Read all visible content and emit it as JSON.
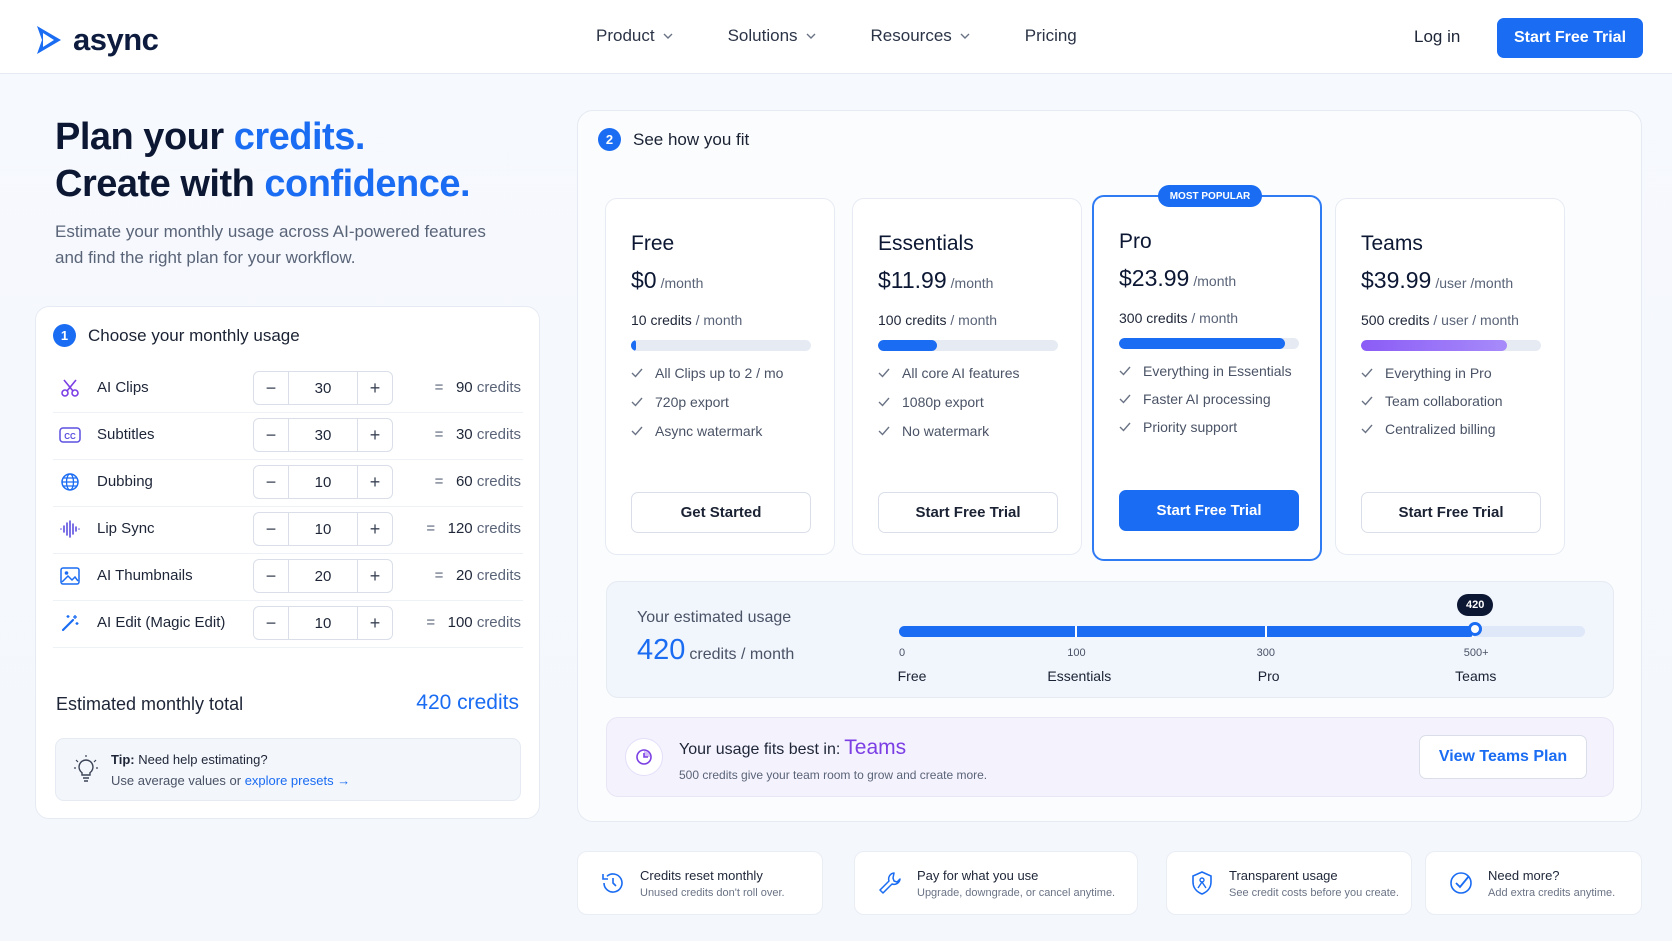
{
  "nav": {
    "brand": "async",
    "menu": [
      "Product",
      "Solutions",
      "Resources",
      "Pricing"
    ],
    "login": "Log in",
    "cta": "Start Free Trial"
  },
  "hero": {
    "l1a": "Plan your ",
    "l1b": "credits.",
    "l2a": "Create with ",
    "l2b": "confidence.",
    "sub": "Estimate your monthly usage across AI-powered features and find the right plan for your workflow."
  },
  "usage": {
    "step": "1",
    "title": "Choose your monthly usage",
    "rows": [
      {
        "label": "AI Clips",
        "value": "30",
        "eq": "=",
        "credits": "90",
        "unit": "credits",
        "icon": "scissors-icon"
      },
      {
        "label": "Subtitles",
        "value": "30",
        "eq": "=",
        "credits": "30",
        "unit": "credits",
        "icon": "cc-icon"
      },
      {
        "label": "Dubbing",
        "value": "10",
        "eq": "=",
        "credits": "60",
        "unit": "credits",
        "icon": "globe-icon"
      },
      {
        "label": "Lip Sync",
        "value": "10",
        "eq": "=",
        "credits": "120",
        "unit": "credits",
        "icon": "waveform-icon"
      },
      {
        "label": "AI Thumbnails",
        "value": "20",
        "eq": "=",
        "credits": "20",
        "unit": "credits",
        "icon": "image-icon"
      },
      {
        "label": "AI Edit (Magic Edit)",
        "value": "10",
        "eq": "=",
        "credits": "100",
        "unit": "credits",
        "icon": "magic-wand-icon"
      }
    ],
    "minus": "−",
    "plus": "+",
    "total_label": "Estimated monthly total",
    "total_value": "420 credits",
    "tip_title": "Tip:",
    "tip_title_rest": " Need help estimating?",
    "tip_body": "Use average values or ",
    "tip_link": "explore presets",
    "tip_arrow": "→"
  },
  "fit": {
    "step": "2",
    "title": "See how you fit",
    "plans": [
      {
        "name": "Free",
        "price": "$0",
        "period": "/month",
        "credits": "10 credits",
        "credits_unit": " / month",
        "fill": 0.03,
        "bar_color": "#1a6cf2",
        "features": [
          "All Clips up to 2 / mo",
          "720p export",
          "Async watermark"
        ],
        "button": "Get Started",
        "primary": false
      },
      {
        "name": "Essentials",
        "price": "$11.99",
        "period": "/month",
        "credits": "100 credits",
        "credits_unit": " / month",
        "fill": 0.33,
        "bar_color": "#1a6cf2",
        "features": [
          "All core AI features",
          "1080p export",
          "No watermark"
        ],
        "button": "Start Free Trial",
        "primary": false
      },
      {
        "name": "Pro",
        "price": "$23.99",
        "period": "/month",
        "credits": "300 credits",
        "credits_unit": " / month",
        "fill": 0.92,
        "bar_color": "#1a6cf2",
        "features": [
          "Everything in Essentials",
          "Faster AI processing",
          "Priority support"
        ],
        "button": "Start Free Trial",
        "primary": true,
        "badge": "MOST POPULAR"
      },
      {
        "name": "Teams",
        "price": "$39.99",
        "period": "/user /month",
        "credits": "500 credits",
        "credits_unit": " / user / month",
        "fill": 0.81,
        "bar_color": "#8b5cf6",
        "features": [
          "Everything in Pro",
          "Team collaboration",
          "Centralized billing"
        ],
        "button": "Start Free Trial",
        "primary": false
      }
    ],
    "estimate_label": "Your estimated usage",
    "estimate_value": "420",
    "estimate_unit": "credits / month",
    "bubble": "420",
    "usage_fill": 0.84,
    "scale": [
      {
        "tick": "0",
        "name": "Free",
        "pos": 0.0
      },
      {
        "tick": "100",
        "name": "Essentials",
        "pos": 0.257
      },
      {
        "tick": "300",
        "name": "Pro",
        "pos": 0.533
      },
      {
        "tick": "500+",
        "name": "Teams",
        "pos": 0.835
      }
    ],
    "best_label": "Your usage fits best in:",
    "best_plan": "Teams",
    "best_sub": "500 credits give your team room to grow and create more.",
    "best_button": "View Teams Plan"
  },
  "footer": [
    {
      "title": "Credits reset monthly",
      "sub": "Unused credits don't roll over.",
      "icon": "clock-reset-icon"
    },
    {
      "title": "Pay for what you use",
      "sub": "Upgrade, downgrade, or cancel anytime.",
      "icon": "wrench-icon"
    },
    {
      "title": "Transparent usage",
      "sub": "See credit costs before you create.",
      "icon": "shield-icon"
    },
    {
      "title": "Need more?",
      "sub": "Add extra credits anytime.",
      "icon": "check-circle-icon"
    }
  ]
}
